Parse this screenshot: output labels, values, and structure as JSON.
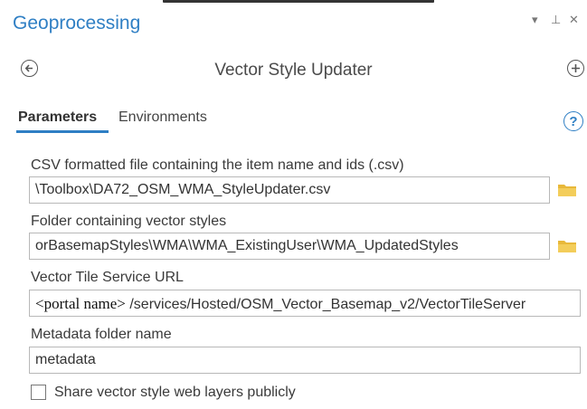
{
  "header": {
    "title": "Geoprocessing",
    "dropdown_glyph": "▾",
    "pin_glyph": "⊥",
    "close_glyph": "✕"
  },
  "tool": {
    "title": "Vector Style Updater",
    "back_icon": "back-arrow-icon",
    "add_icon": "plus-icon"
  },
  "tabs": [
    {
      "label": "Parameters",
      "active": true
    },
    {
      "label": "Environments",
      "active": false
    }
  ],
  "help_glyph": "?",
  "params": [
    {
      "label": "CSV formatted file containing the item name and ids (.csv)",
      "value": "\\Toolbox\\DA72_OSM_WMA_StyleUpdater.csv",
      "icon": "folder-icon"
    },
    {
      "label": "Folder containing vector styles",
      "value": "orBasemapStyles\\WMA\\WMA_ExistingUser\\WMA_UpdatedStyles",
      "icon": "folder-icon"
    },
    {
      "label": "Vector Tile Service URL",
      "value_prefix": "<portal name>",
      "value": " /services/Hosted/OSM_Vector_Basemap_v2/VectorTileServer"
    },
    {
      "label": "Metadata folder name",
      "value": "metadata"
    }
  ],
  "share_checkbox": {
    "label": "Share vector style web layers publicly",
    "checked": false
  },
  "colors": {
    "accent": "#2f7fc4",
    "folder": "#e8b83a"
  }
}
